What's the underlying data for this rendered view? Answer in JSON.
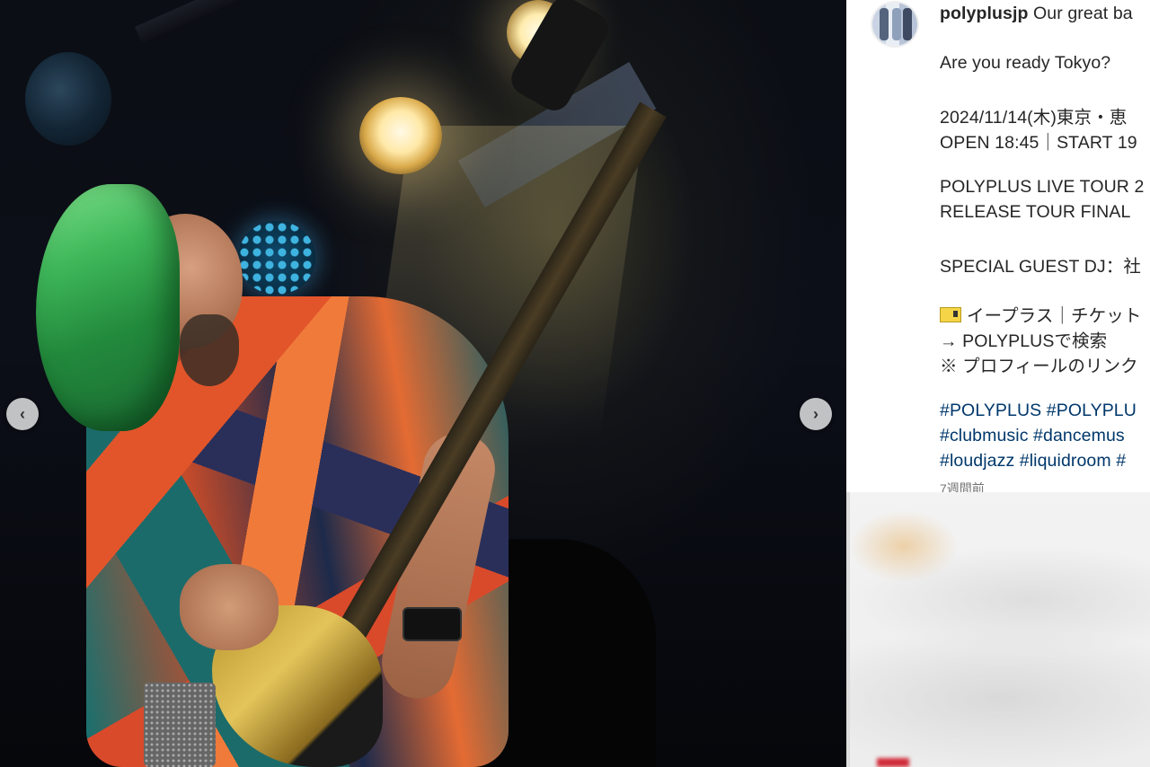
{
  "photo": {
    "prev_label": "‹",
    "next_label": "›"
  },
  "caption": {
    "username": "polyplusjp",
    "lines": [
      "Our great ba",
      "Are you ready Tokyo?",
      "2024/11/14(木)東京・恵",
      "OPEN 18:45｜START 19",
      "POLYPLUS LIVE TOUR 2",
      "RELEASE TOUR FINAL",
      "SPECIAL GUEST DJ：社",
      "イープラス｜チケット",
      "→ POLYPLUSで検索",
      "※ プロフィールのリンク"
    ],
    "hashtags": [
      "#POLYPLUS #POLYPLU",
      "#clubmusic #dancemus",
      "#loudjazz #liquidroom #"
    ],
    "time_ago": "7週間前"
  },
  "icons": {
    "prev": "chevron-left-icon",
    "next": "chevron-right-icon",
    "ticket": "ticket-icon"
  }
}
